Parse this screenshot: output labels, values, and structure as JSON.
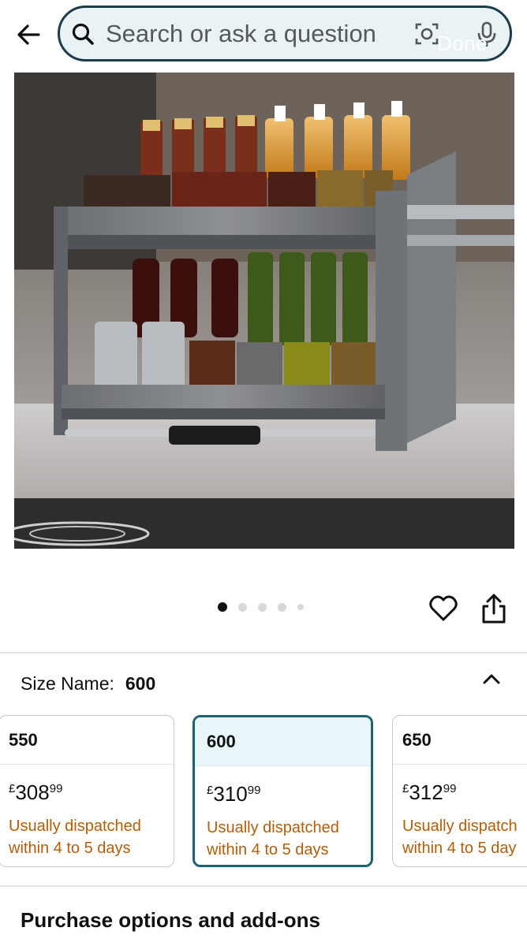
{
  "search": {
    "placeholder": "Search or ask a question",
    "done_label": "Done"
  },
  "product": {
    "image_alt": "Pull-down spice rack with bottles and jars",
    "carousel": {
      "count": 5,
      "active_index": 0
    }
  },
  "size": {
    "label": "Size Name:",
    "selected_value": "600",
    "options": [
      {
        "name": "550",
        "currency": "£",
        "price_whole": "308",
        "price_fraction": "99",
        "dispatch_line1": "Usually dispatched",
        "dispatch_line2": "within 4 to 5 days"
      },
      {
        "name": "600",
        "currency": "£",
        "price_whole": "310",
        "price_fraction": "99",
        "dispatch_line1": "Usually dispatched",
        "dispatch_line2": "within 4 to 5 days"
      },
      {
        "name": "650",
        "currency": "£",
        "price_whole": "312",
        "price_fraction": "99",
        "dispatch_line1": "Usually dispatch",
        "dispatch_line2": "within 4 to 5 day"
      }
    ]
  },
  "purchase_section": {
    "heading": "Purchase options and add-ons"
  },
  "colors": {
    "accent": "#1e6272",
    "dispatch": "#b25e08",
    "search_bg": "#e9f3f6"
  }
}
